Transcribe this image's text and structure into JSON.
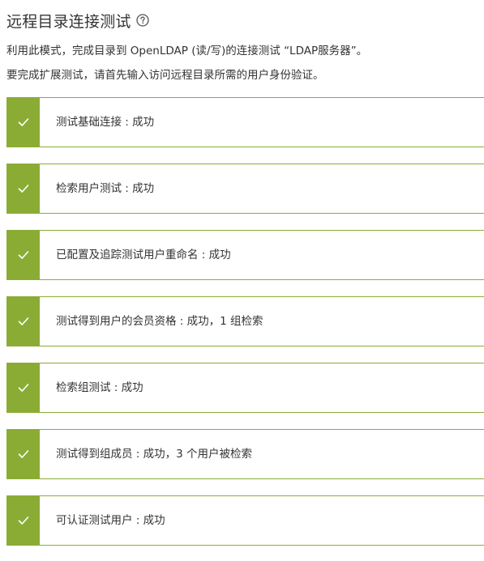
{
  "header": {
    "title": "远程目录连接测试",
    "help_icon": "question-circle-icon"
  },
  "description": {
    "line1": "利用此模式，完成目录到 OpenLDAP (读/写)的连接测试 “LDAP服务器”。",
    "line2": "要完成扩展测试，请首先输入访问远程目录所需的用户身份验证。"
  },
  "colors": {
    "success": "#8aac35"
  },
  "results": [
    {
      "label": "测试基础连接 : 成功",
      "icon": "check-icon",
      "status": "success"
    },
    {
      "label": "检索用户测试 : 成功",
      "icon": "check-icon",
      "status": "success"
    },
    {
      "label": "已配置及追踪测试用户重命名 : 成功",
      "icon": "check-icon",
      "status": "success"
    },
    {
      "label": "测试得到用户的会员资格 : 成功，1 组检索",
      "icon": "check-icon",
      "status": "success"
    },
    {
      "label": "检索组测试 : 成功",
      "icon": "check-icon",
      "status": "success"
    },
    {
      "label": "测试得到组成员 : 成功，3 个用户被检索",
      "icon": "check-icon",
      "status": "success"
    },
    {
      "label": "可认证测试用户 : 成功",
      "icon": "check-icon",
      "status": "success"
    }
  ]
}
